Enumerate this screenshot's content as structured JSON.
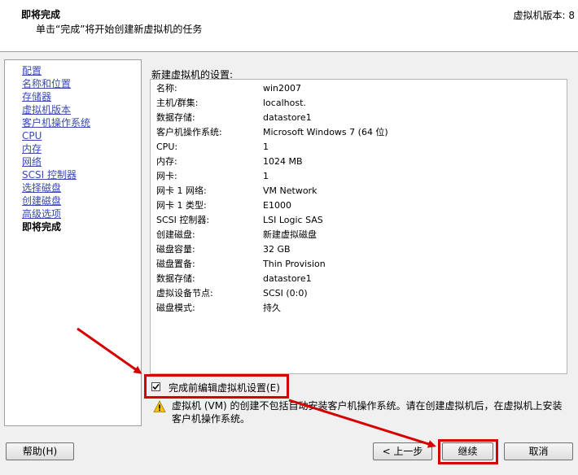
{
  "header": {
    "title": "即将完成",
    "subtitle": "单击“完成”将开始创建新虚拟机的任务",
    "version": "虚拟机版本: 8"
  },
  "nav": {
    "items": [
      {
        "label": "配置"
      },
      {
        "label": "名称和位置"
      },
      {
        "label": "存储器"
      },
      {
        "label": "虚拟机版本"
      },
      {
        "label": "客户机操作系统"
      },
      {
        "label": "CPU"
      },
      {
        "label": "内存"
      },
      {
        "label": "网络"
      },
      {
        "label": "SCSI 控制器"
      },
      {
        "label": "选择磁盘"
      },
      {
        "label": "创建磁盘"
      },
      {
        "label": "高级选项"
      },
      {
        "label": "即将完成",
        "current": true
      }
    ]
  },
  "settings": {
    "label": "新建虚拟机的设置:",
    "rows": [
      {
        "key": "名称:",
        "value": "win2007"
      },
      {
        "key": "主机/群集:",
        "value": "localhost."
      },
      {
        "key": "数据存储:",
        "value": "datastore1"
      },
      {
        "key": "客户机操作系统:",
        "value": "Microsoft Windows 7 (64 位)"
      },
      {
        "key": "CPU:",
        "value": "1"
      },
      {
        "key": "内存:",
        "value": "1024 MB"
      },
      {
        "key": "网卡:",
        "value": "1"
      },
      {
        "key": "网卡 1 网络:",
        "value": "VM Network"
      },
      {
        "key": "网卡 1 类型:",
        "value": "E1000"
      },
      {
        "key": "SCSI 控制器:",
        "value": "LSI Logic SAS"
      },
      {
        "key": "创建磁盘:",
        "value": "新建虚拟磁盘"
      },
      {
        "key": "磁盘容量:",
        "value": "32 GB"
      },
      {
        "key": "磁盘置备:",
        "value": "Thin Provision"
      },
      {
        "key": "数据存储:",
        "value": "datastore1"
      },
      {
        "key": "虚拟设备节点:",
        "value": "SCSI (0:0)"
      },
      {
        "key": "磁盘模式:",
        "value": "持久"
      }
    ]
  },
  "edit_checkbox": {
    "label": "完成前编辑虚拟机设置(E)",
    "checked": true
  },
  "warning": {
    "icon": "warning-icon",
    "text": "虚拟机 (VM) 的创建不包括自动安装客户机操作系统。请在创建虚拟机后，在虚拟机上安装客户机操作系统。"
  },
  "buttons": {
    "help": "帮助(H)",
    "back": "< 上一步",
    "next": "继续",
    "cancel": "取消"
  },
  "colors": {
    "link": "#3a4ab4",
    "highlight": "#d60000",
    "header_bg": "#ffffff",
    "window_bg": "#f0f0f0"
  }
}
